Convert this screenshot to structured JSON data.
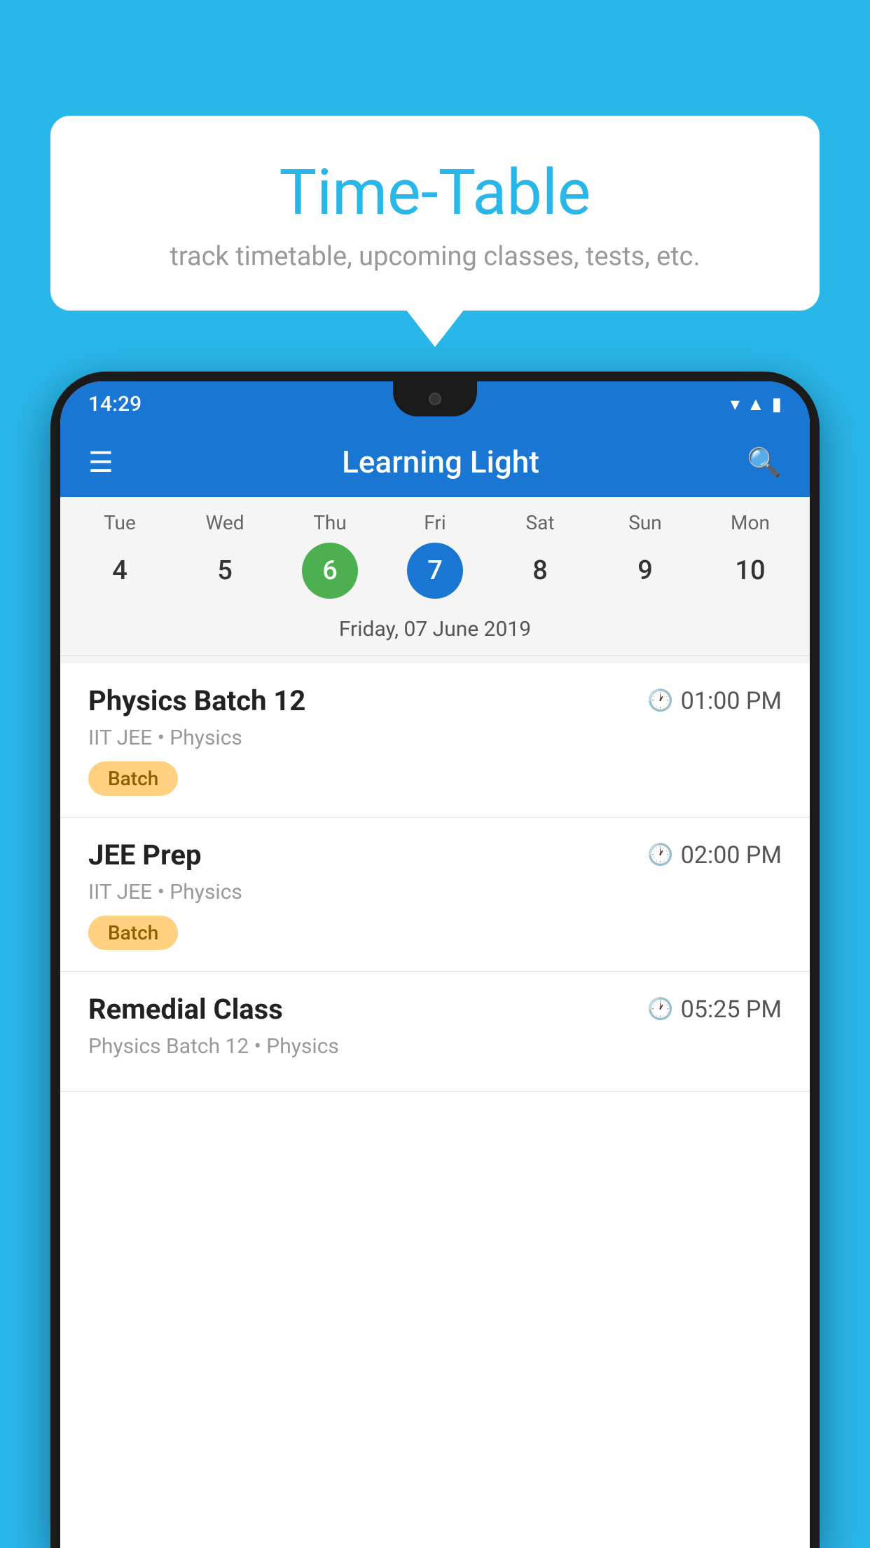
{
  "background": {
    "color": "#29b6e8"
  },
  "speech_bubble": {
    "title": "Time-Table",
    "subtitle": "track timetable, upcoming classes, tests, etc."
  },
  "phone": {
    "status_bar": {
      "time": "14:29"
    },
    "app_bar": {
      "title": "Learning Light"
    },
    "calendar": {
      "days": [
        "Tue",
        "Wed",
        "Thu",
        "Fri",
        "Sat",
        "Sun",
        "Mon"
      ],
      "dates": [
        "4",
        "5",
        "6",
        "7",
        "8",
        "9",
        "10"
      ],
      "today_index": 2,
      "selected_index": 3,
      "selected_date_label": "Friday, 07 June 2019"
    },
    "classes": [
      {
        "name": "Physics Batch 12",
        "time": "01:00 PM",
        "meta": "IIT JEE • Physics",
        "badge": "Batch"
      },
      {
        "name": "JEE Prep",
        "time": "02:00 PM",
        "meta": "IIT JEE • Physics",
        "badge": "Batch"
      },
      {
        "name": "Remedial Class",
        "time": "05:25 PM",
        "meta": "Physics Batch 12 • Physics",
        "badge": null
      }
    ]
  }
}
